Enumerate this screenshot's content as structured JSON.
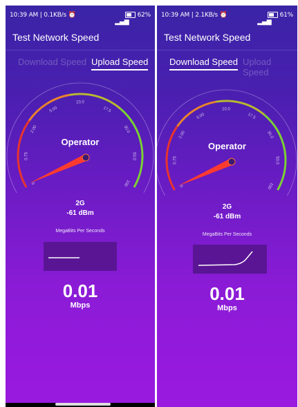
{
  "screens": [
    {
      "status": {
        "time_info": "10:39 AM | 0.1KB/s",
        "battery": "62%"
      },
      "title": "Test Network Speed",
      "tabs": {
        "download": "Download Speed",
        "upload": "Upload Speed",
        "active": "upload"
      },
      "gauge": {
        "ticks": [
          "0",
          "0.75",
          "2.00",
          "5.00",
          "10.0",
          "17.5",
          "30.0",
          "50.0",
          "100"
        ],
        "operator": "Operator",
        "network": "2G",
        "signal": "-61 dBm",
        "unit_label": "MegaBits Per Seconds"
      },
      "speed": {
        "value": "0.01",
        "unit": "Mbps"
      },
      "graph": {
        "shape": "flat"
      }
    },
    {
      "status": {
        "time_info": "10:39 AM | 2.1KB/s",
        "battery": "61%"
      },
      "title": "Test Network Speed",
      "tabs": {
        "download": "Download Speed",
        "upload": "Upload Speed",
        "active": "download"
      },
      "gauge": {
        "ticks": [
          "0",
          "0.75",
          "2.00",
          "5.00",
          "10.0",
          "17.5",
          "30.0",
          "50.0",
          "100"
        ],
        "operator": "Operator",
        "network": "2G",
        "signal": "-61 dBm",
        "unit_label": "MegaBits Per Seconds"
      },
      "speed": {
        "value": "0.01",
        "unit": "Mbps"
      },
      "graph": {
        "shape": "rising"
      }
    }
  ],
  "colors": {
    "arc_red": "#e8342e",
    "arc_orange": "#e8832e",
    "arc_green": "#7ad133",
    "needle": "#ff3b2f"
  }
}
